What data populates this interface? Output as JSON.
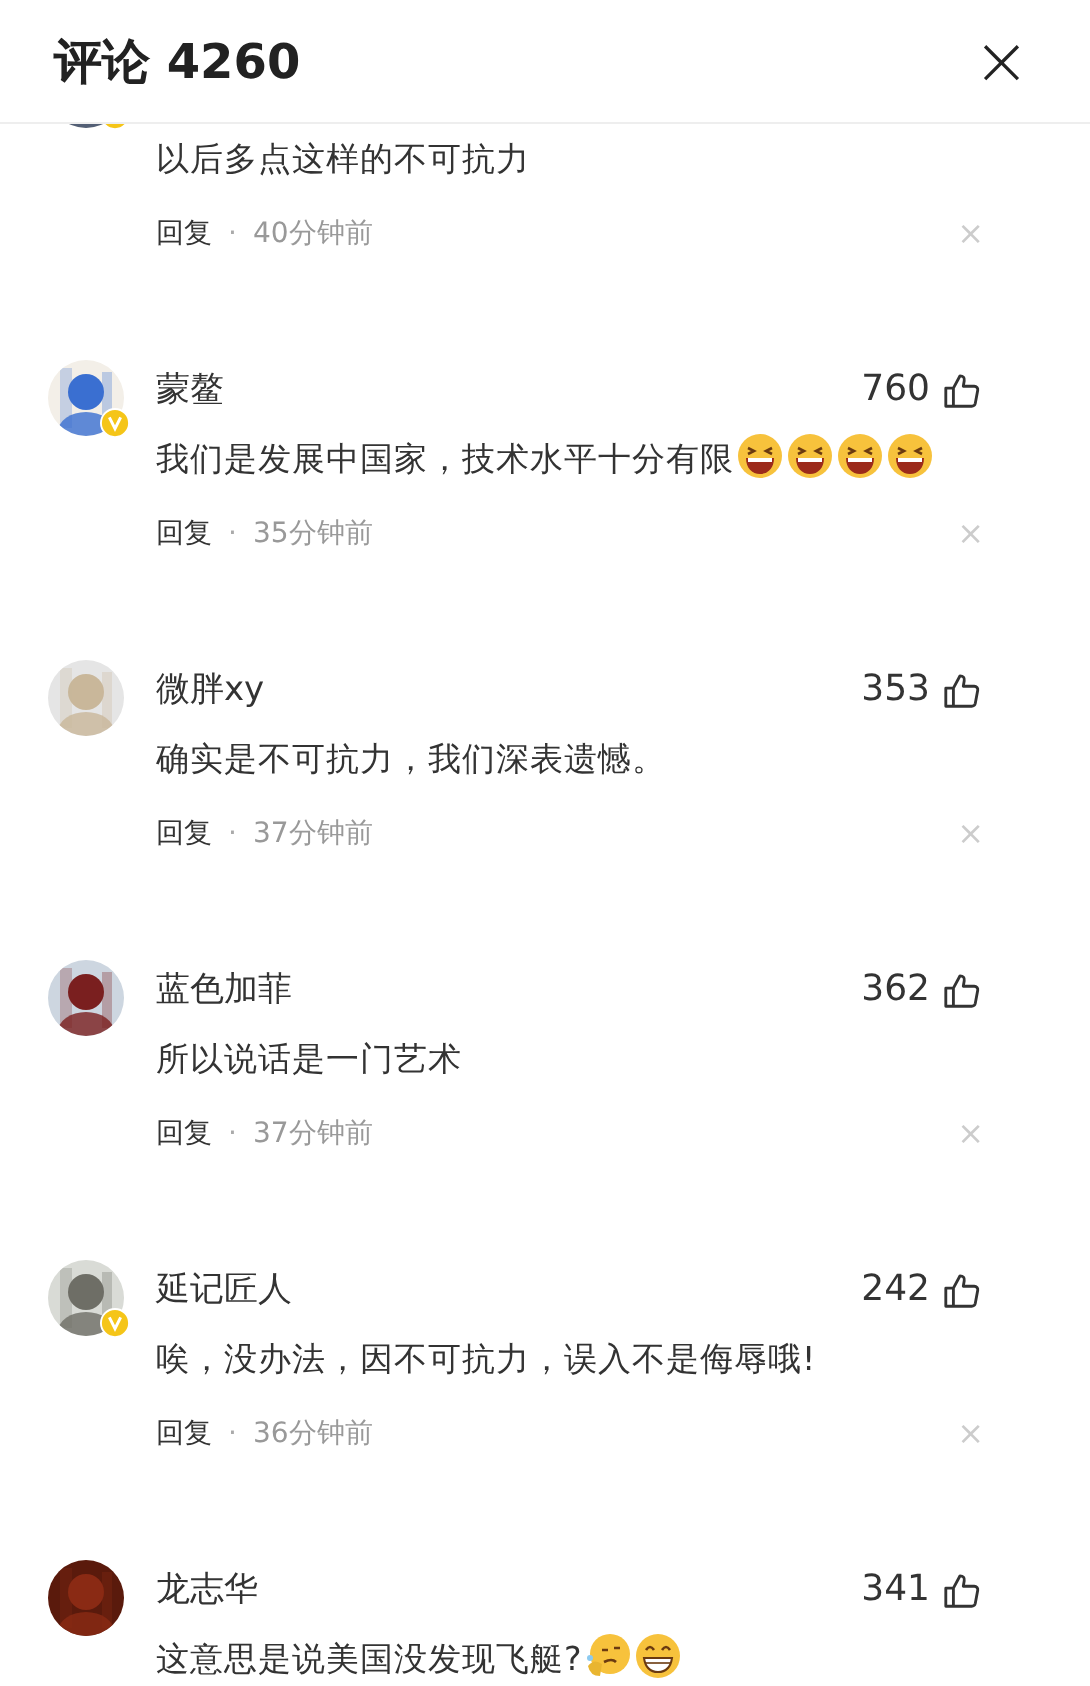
{
  "header": {
    "title": "评论 4260",
    "close": "×"
  },
  "comments": [
    {
      "partial": true,
      "verified": true,
      "text": "以后多点这样的不可抗力",
      "reply": "回复",
      "dot": "·",
      "time": "40分钟前",
      "dismiss": "×"
    },
    {
      "partial": false,
      "name": "蒙鳌",
      "likes": "760",
      "verified": true,
      "text": "我们是发展中国家，技术水平十分有限",
      "emojis": [
        {
          "kind": "laugh"
        },
        {
          "kind": "laugh"
        },
        {
          "kind": "laugh"
        },
        {
          "kind": "laugh"
        }
      ],
      "reply": "回复",
      "dot": "·",
      "time": "35分钟前",
      "dismiss": "×"
    },
    {
      "partial": false,
      "name": "微胖xy",
      "likes": "353",
      "verified": false,
      "text": "确实是不可抗力，我们深表遗憾。",
      "reply": "回复",
      "dot": "·",
      "time": "37分钟前",
      "dismiss": "×"
    },
    {
      "partial": false,
      "name": "蓝色加菲",
      "likes": "362",
      "verified": false,
      "text": "所以说话是一门艺术",
      "reply": "回复",
      "dot": "·",
      "time": "37分钟前",
      "dismiss": "×"
    },
    {
      "partial": false,
      "name": "延记匠人",
      "likes": "242",
      "verified": true,
      "text": "唉，没办法，因不可抗力，误入不是侮辱哦!",
      "reply": "回复",
      "dot": "·",
      "time": "36分钟前",
      "dismiss": "×"
    },
    {
      "partial": false,
      "name": "龙志华",
      "likes": "341",
      "verified": false,
      "text": "这意思是说美国没发现飞艇?",
      "emojis": [
        {
          "kind": "think"
        },
        {
          "kind": "grin"
        }
      ]
    }
  ]
}
